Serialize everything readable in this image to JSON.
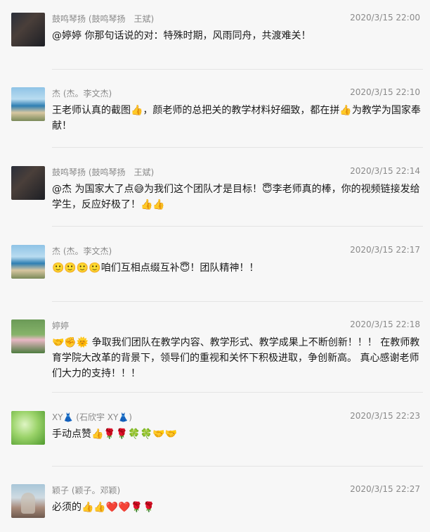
{
  "messages": [
    {
      "name": "鼓鸣琴扬 (鼓鸣琴扬　王斌)",
      "time": "2020/3/15 22:00",
      "text": "@婷婷 你那句话说的对：特殊时期，风雨同舟，共渡难关！",
      "avatar": "drum"
    },
    {
      "name": "杰 (杰。李文杰)",
      "time": "2020/3/15 22:10",
      "text": "王老师认真的截图👍，颜老师的总把关的教学材料好细致，都在拼👍为教学为国家奉献！",
      "avatar": "sea"
    },
    {
      "name": "鼓鸣琴扬 (鼓鸣琴扬　王斌)",
      "time": "2020/3/15 22:14",
      "text": "@杰 为国家大了点😅为我们这个团队才是目标！😇李老师真的棒，你的视频链接发给学生，反应好极了！👍👍",
      "avatar": "drum"
    },
    {
      "name": "杰 (杰。李文杰)",
      "time": "2020/3/15 22:17",
      "text": "🙂🙂🙂🙂咱们互相点缀互补😇！团队精神！！",
      "avatar": "sea"
    },
    {
      "name": "婷婷",
      "time": "2020/3/15 22:18",
      "text": "🤝✊🌞  争取我们团队在教学内容、教学形式、教学成果上不断创新！！！ 在教师教育学院大改革的背景下，领导们的重视和关怀下积极进取，争创新高。 真心感谢老师们大力的支持！！！",
      "avatar": "lotus"
    },
    {
      "name": "XY👗 (石欣宇  XY👗)",
      "time": "2020/3/15 22:23",
      "text": "手动点赞👍🌹🌹🍀🍀🤝🤝",
      "avatar": "green"
    },
    {
      "name": "颖子 (颖子。邓颖)",
      "time": "2020/3/15 22:27",
      "text": "必须的👍👍❤️❤️🌹🌹",
      "avatar": "beach"
    }
  ]
}
